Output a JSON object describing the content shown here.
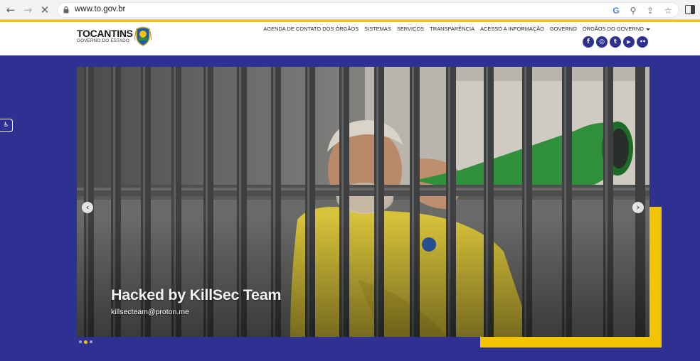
{
  "browser": {
    "url": "www.to.gov.br",
    "icons": [
      "back-arrow-icon",
      "forward-arrow-icon",
      "stop-loading-icon",
      "lock-icon",
      "google-icon",
      "zoom-icon",
      "share-icon",
      "bookmark-star-icon",
      "side-panel-icon"
    ],
    "google_letter": "G"
  },
  "site": {
    "logo_title": "TOCANTINS",
    "logo_subtitle": "GOVERNO DO ESTADO",
    "nav": [
      {
        "label": "AGENDA DE CONTATO DOS ÓRGÃOS"
      },
      {
        "label": "SISTEMAS"
      },
      {
        "label": "SERVIÇOS"
      },
      {
        "label": "TRANSPARÊNCIA"
      },
      {
        "label": "ACESSO A INFORMAÇÃO"
      },
      {
        "label": "GOVERNO"
      },
      {
        "label": "ÓRGÃOS DO GOVERNO"
      }
    ],
    "social": [
      {
        "name": "facebook-icon",
        "glyph": "f"
      },
      {
        "name": "instagram-icon",
        "glyph": "◎"
      },
      {
        "name": "twitter-icon",
        "glyph": "t"
      },
      {
        "name": "youtube-icon",
        "glyph": "▶"
      },
      {
        "name": "flickr-icon",
        "glyph": "••"
      }
    ],
    "colors": {
      "brand_blue": "#2e3192",
      "accent_yellow": "#f5c400"
    }
  },
  "carousel": {
    "caption_title": "Hacked by KillSec Team",
    "caption_subtitle": "killsecteam@proton.me",
    "prev_glyph": "‹",
    "next_glyph": "›",
    "slide_count": 3,
    "active_slide": 2
  },
  "accessibility": {
    "glyph": "♿"
  }
}
